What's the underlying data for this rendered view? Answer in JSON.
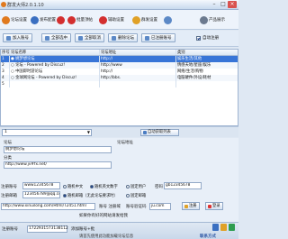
{
  "window": {
    "title": "群发大师2.0.1.10",
    "min": "–",
    "max": "□",
    "close": "×"
  },
  "toolbar": {
    "items": [
      {
        "label": "论坛设置",
        "icon": "forum-icon",
        "color": "#e07a1f"
      },
      {
        "label": "发布配置",
        "icon": "publish-icon",
        "color": "#3a6fc1"
      },
      {
        "label": "",
        "icon": "red-dot-icon",
        "color": "#d32f2f"
      },
      {
        "label": "批量顶帖",
        "icon": "bump-icon",
        "color": "#d32f2f"
      },
      {
        "label": "辅助设置",
        "icon": "assist-icon",
        "color": "#d32f2f"
      },
      {
        "label": "群发设置",
        "icon": "mass-send-icon",
        "color": "#e0a127"
      },
      {
        "label": "",
        "icon": "user-icon",
        "color": "#5b88c6"
      },
      {
        "label": "产品展示",
        "icon": "product-icon",
        "color": "#6c7a8f"
      }
    ]
  },
  "actions": {
    "add_account": "加入账号",
    "select_all": "全部选中",
    "select_all2": "全部取消",
    "open_forum": "删除论坛",
    "logged_in": "已注册账号",
    "auto_reg": "自动注册"
  },
  "grid": {
    "headers": [
      "序号",
      "论坛名称",
      "论坛地址",
      "类别"
    ],
    "rows": [
      [
        "1",
        "● 姚梦想论坛",
        "http://",
        "娱乐生活/其他"
      ],
      [
        "2",
        "○ 论坛 - Powered by Discuz!",
        "http://www",
        "情感天地/星座/娱乐"
      ],
      [
        "3",
        "○ 中国即时游论坛",
        "http://",
        "网络/生活/购物"
      ],
      [
        "4",
        "○ 金球网论坛 - Powered by Discuz!",
        "http://bbs.",
        "电脑硬件/外设/耗材"
      ],
      [
        "5",
        "",
        "",
        ""
      ]
    ],
    "selected_row": 0
  },
  "filter": {
    "dropdown_value": "1",
    "fetch_button": "自动获取列表"
  },
  "form": {
    "forum_label": "论坛",
    "forum_value": "姚梦想论坛",
    "addr_label": "论坛地址",
    "addr_value": "http://www.jv#fx.net/",
    "cat_label": "分类",
    "account_label": "注册账号",
    "account_value": "www12345678",
    "rand_cn": "随机中文",
    "rand_en": "随机英文数字",
    "fixed_user": "固定用户",
    "pwd_label": "密码",
    "pwd_value": "gb12345678",
    "email_label": "注册邮箱",
    "email_value": "123456789@qq.com",
    "rand_mail": "随机邮箱（无此论坛要求时）",
    "fixed_mail": "固定邮箱",
    "url_value": "http://www.xinuilong.com/Html/T2451.html",
    "url_note": "账号 注册域",
    "verify_label": "账号验证码",
    "verify_value": "ju.com",
    "reg_button": "注册",
    "sign_button": "登录",
    "tip": "如果你有好的网站请发给我"
  },
  "status": {
    "caption": "注册账号",
    "input_value": "1722931573138112",
    "mid_label": "添加账号+批",
    "note": "请首先使用此功能加载论坛信息",
    "brand": "联系方式"
  }
}
